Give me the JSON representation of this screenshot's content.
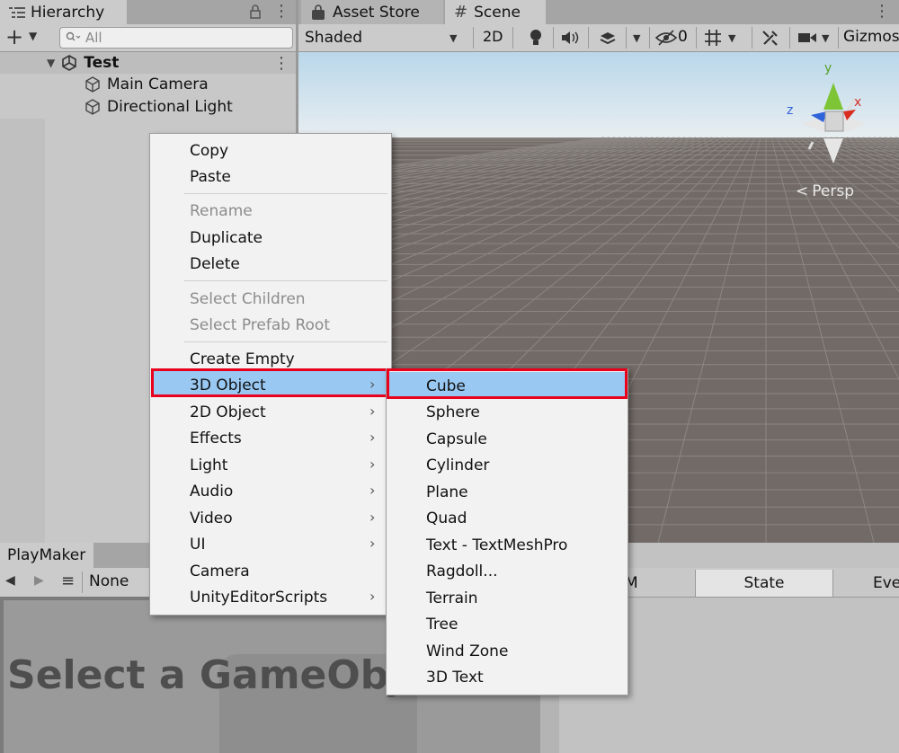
{
  "hierarchy": {
    "tab_title": "Hierarchy",
    "search_placeholder": "All",
    "scene_name": "Test",
    "items": [
      "Main Camera",
      "Directional Light"
    ]
  },
  "scene": {
    "tabs": [
      "Asset Store",
      "Scene"
    ],
    "shading_mode": "Shaded",
    "mode_2d": "2D",
    "hidden_count": "0",
    "gizmos_label": "Gizmos",
    "persp_label": "Persp",
    "axis_labels": {
      "y": "y",
      "z": "z",
      "x": "x"
    }
  },
  "playmaker": {
    "tab_title": "PlayMaker",
    "fsm_select": "None",
    "placeholder_text": "Select a GameObj",
    "fsm_tabs": [
      "M",
      "State",
      "Eve"
    ]
  },
  "context_menu": {
    "group1": [
      "Copy",
      "Paste"
    ],
    "group2": [
      {
        "label": "Rename",
        "disabled": true
      },
      {
        "label": "Duplicate",
        "disabled": false
      },
      {
        "label": "Delete",
        "disabled": false
      }
    ],
    "group3": [
      {
        "label": "Select Children",
        "disabled": true
      },
      {
        "label": "Select Prefab Root",
        "disabled": true
      }
    ],
    "group4": [
      {
        "label": "Create Empty",
        "submenu": false
      },
      {
        "label": "3D Object",
        "submenu": true,
        "highlighted": true
      },
      {
        "label": "2D Object",
        "submenu": true
      },
      {
        "label": "Effects",
        "submenu": true
      },
      {
        "label": "Light",
        "submenu": true
      },
      {
        "label": "Audio",
        "submenu": true
      },
      {
        "label": "Video",
        "submenu": true
      },
      {
        "label": "UI",
        "submenu": true
      },
      {
        "label": "Camera",
        "submenu": false
      },
      {
        "label": "UnityEditorScripts",
        "submenu": true
      }
    ]
  },
  "submenu_3d": {
    "items": [
      "Cube",
      "Sphere",
      "Capsule",
      "Cylinder",
      "Plane",
      "Quad",
      "Text - TextMeshPro",
      "Ragdoll...",
      "Terrain",
      "Tree",
      "Wind Zone",
      "3D Text"
    ],
    "highlighted": "Cube"
  },
  "colors": {
    "highlight": "#99c9f3",
    "annotation_red": "#e8001c",
    "scene_ground": "#716a66",
    "scene_sky": "#b9d7ea"
  }
}
